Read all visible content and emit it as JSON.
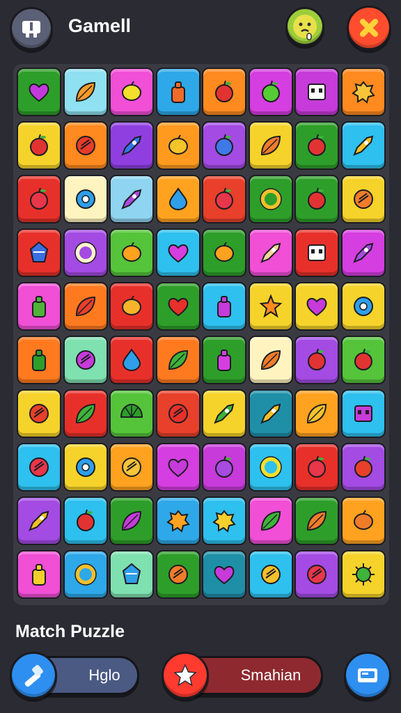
{
  "header": {
    "title": "Gamell",
    "home_icon": "home-grid-icon",
    "emoji_icon": "sick-face-icon",
    "close_icon": "close-x-icon"
  },
  "footer": {
    "title": "Match Puzzle",
    "help_label": "Hglo",
    "share_label": "Smahian",
    "help_icon": "hammer-icon",
    "share_icon": "star-icon",
    "card_icon": "card-icon"
  },
  "board": {
    "rows": [
      [
        {
          "bg": "#2e9e2a",
          "icon": "heart",
          "color": "#c23adb"
        },
        {
          "bg": "#8fe0f0",
          "icon": "leaf",
          "color": "#f59b2a"
        },
        {
          "bg": "#f04fd6",
          "icon": "lemon",
          "color": "#f3e02b"
        },
        {
          "bg": "#2ea8e8",
          "icon": "bottle",
          "color": "#f06a2a"
        },
        {
          "bg": "#ff8a1f",
          "icon": "apple",
          "color": "#e23333"
        },
        {
          "bg": "#d53ee0",
          "icon": "apple",
          "color": "#55cc33"
        },
        {
          "bg": "#c63bd9",
          "icon": "robot",
          "color": "#ffffff"
        },
        {
          "bg": "#ff8a1f",
          "icon": "splat",
          "color": "#f7c43a"
        }
      ],
      [
        {
          "bg": "#f6d32a",
          "icon": "apple",
          "color": "#e23333"
        },
        {
          "bg": "#ff8a1f",
          "icon": "coin",
          "color": "#e83b2a"
        },
        {
          "bg": "#8f3fe0",
          "icon": "rocket",
          "color": "#3577e8"
        },
        {
          "bg": "#ff9a1f",
          "icon": "lemon",
          "color": "#f5c42b"
        },
        {
          "bg": "#a34be3",
          "icon": "apple",
          "color": "#3f79e8"
        },
        {
          "bg": "#f6d32a",
          "icon": "leaf",
          "color": "#f07c2a"
        },
        {
          "bg": "#2e9e2a",
          "icon": "apple",
          "color": "#e23333"
        },
        {
          "bg": "#2ec0ee",
          "icon": "rocket",
          "color": "#f3c02b"
        }
      ],
      [
        {
          "bg": "#e8302a",
          "icon": "apple",
          "color": "#e8364a"
        },
        {
          "bg": "#fff4bf",
          "icon": "flower",
          "color": "#2e9fe8"
        },
        {
          "bg": "#8fd4f0",
          "icon": "rocket",
          "color": "#a84be0"
        },
        {
          "bg": "#ffa21f",
          "icon": "drop",
          "color": "#2e9fe8"
        },
        {
          "bg": "#e8402a",
          "icon": "apple",
          "color": "#e8364a"
        },
        {
          "bg": "#2e9e2a",
          "icon": "ring",
          "color": "#f3c02b"
        },
        {
          "bg": "#2e9e2a",
          "icon": "apple",
          "color": "#e23333"
        },
        {
          "bg": "#f6d32a",
          "icon": "coin",
          "color": "#f07c2a"
        }
      ],
      [
        {
          "bg": "#e8302a",
          "icon": "gem",
          "color": "#3a6fe0"
        },
        {
          "bg": "#a34be3",
          "icon": "ring",
          "color": "#fff4cf"
        },
        {
          "bg": "#55c43a",
          "icon": "lemon",
          "color": "#ffa21f"
        },
        {
          "bg": "#2ec0ee",
          "icon": "heart",
          "color": "#d63ee0"
        },
        {
          "bg": "#2e9e2a",
          "icon": "lemon",
          "color": "#ffa21f"
        },
        {
          "bg": "#f04fd6",
          "icon": "rocket",
          "color": "#f7d49a"
        },
        {
          "bg": "#e8302a",
          "icon": "robot",
          "color": "#ffffff"
        },
        {
          "bg": "#d53ee0",
          "icon": "rocket",
          "color": "#a84be0"
        }
      ],
      [
        {
          "bg": "#f04fd6",
          "icon": "bottle",
          "color": "#4fb33a"
        },
        {
          "bg": "#ff7a1f",
          "icon": "leaf",
          "color": "#e8402a"
        },
        {
          "bg": "#e8302a",
          "icon": "lemon",
          "color": "#f7b42b"
        },
        {
          "bg": "#2e9e2a",
          "icon": "heart",
          "color": "#e8302a"
        },
        {
          "bg": "#2ec0ee",
          "icon": "bottle",
          "color": "#c63bd9"
        },
        {
          "bg": "#f6d32a",
          "icon": "star",
          "color": "#ff8a1f"
        },
        {
          "bg": "#f6d32a",
          "icon": "heart",
          "color": "#c63bd9"
        },
        {
          "bg": "#f6d32a",
          "icon": "flower",
          "color": "#2e9fe8"
        }
      ],
      [
        {
          "bg": "#ff7a1f",
          "icon": "bottle",
          "color": "#2e9e2a"
        },
        {
          "bg": "#7fe0b0",
          "icon": "coin",
          "color": "#c63bd9"
        },
        {
          "bg": "#e8302a",
          "icon": "drop",
          "color": "#2e9fe8"
        },
        {
          "bg": "#ff7a1f",
          "icon": "leaf",
          "color": "#3fb33a"
        },
        {
          "bg": "#2e9e2a",
          "icon": "bottle",
          "color": "#d63ee0"
        },
        {
          "bg": "#fff4bf",
          "icon": "leaf",
          "color": "#f07c2a"
        },
        {
          "bg": "#a34be3",
          "icon": "apple",
          "color": "#e23333"
        },
        {
          "bg": "#55c43a",
          "icon": "apple",
          "color": "#e23333"
        }
      ],
      [
        {
          "bg": "#f6d32a",
          "icon": "coin",
          "color": "#e8402a"
        },
        {
          "bg": "#e8302a",
          "icon": "leaf",
          "color": "#3fb33a"
        },
        {
          "bg": "#55c43a",
          "icon": "shell",
          "color": "#2e9e2a"
        },
        {
          "bg": "#e8402a",
          "icon": "coin",
          "color": "#e8302a"
        },
        {
          "bg": "#f6d32a",
          "icon": "rocket",
          "color": "#3fb33a"
        },
        {
          "bg": "#1f8fa8",
          "icon": "rocket",
          "color": "#f3c02b"
        },
        {
          "bg": "#ffa21f",
          "icon": "leaf",
          "color": "#f5c42b"
        },
        {
          "bg": "#2ec0ee",
          "icon": "robot",
          "color": "#c63bd9"
        }
      ],
      [
        {
          "bg": "#2ec0ee",
          "icon": "coin",
          "color": "#e8364a"
        },
        {
          "bg": "#f6d32a",
          "icon": "flower",
          "color": "#2e9fe8"
        },
        {
          "bg": "#ffa21f",
          "icon": "coin",
          "color": "#f7c43a"
        },
        {
          "bg": "#d53ee0",
          "icon": "heart",
          "color": "#c63bd9"
        },
        {
          "bg": "#c63bd9",
          "icon": "apple",
          "color": "#a84be0"
        },
        {
          "bg": "#2ec0ee",
          "icon": "ring",
          "color": "#f3e02b"
        },
        {
          "bg": "#e8302a",
          "icon": "apple",
          "color": "#e8364a"
        },
        {
          "bg": "#a34be3",
          "icon": "apple",
          "color": "#e8402a"
        }
      ],
      [
        {
          "bg": "#a34be3",
          "icon": "rocket",
          "color": "#f3c02b"
        },
        {
          "bg": "#2ec0ee",
          "icon": "apple",
          "color": "#e23333"
        },
        {
          "bg": "#2e9e2a",
          "icon": "leaf",
          "color": "#c63bd9"
        },
        {
          "bg": "#2ea8e8",
          "icon": "splat",
          "color": "#ffa21f"
        },
        {
          "bg": "#2ec0ee",
          "icon": "splat",
          "color": "#f3d02b"
        },
        {
          "bg": "#f04fd6",
          "icon": "leaf",
          "color": "#3fb33a"
        },
        {
          "bg": "#2e9e2a",
          "icon": "leaf",
          "color": "#f07c2a"
        },
        {
          "bg": "#ffa21f",
          "icon": "lemon",
          "color": "#f07c2a"
        }
      ],
      [
        {
          "bg": "#f04fd6",
          "icon": "bottle",
          "color": "#f3d02b"
        },
        {
          "bg": "#2ea8e8",
          "icon": "ring",
          "color": "#f3c02b"
        },
        {
          "bg": "#7fe0b0",
          "icon": "gem",
          "color": "#2e9fe8"
        },
        {
          "bg": "#2e9e2a",
          "icon": "coin",
          "color": "#f07c2a"
        },
        {
          "bg": "#1f8fa8",
          "icon": "heart",
          "color": "#c63bd9"
        },
        {
          "bg": "#2ec0ee",
          "icon": "coin",
          "color": "#f3c02b"
        },
        {
          "bg": "#a34be3",
          "icon": "coin",
          "color": "#e8364a"
        },
        {
          "bg": "#f6d32a",
          "icon": "virus",
          "color": "#3fb33a"
        }
      ]
    ]
  }
}
